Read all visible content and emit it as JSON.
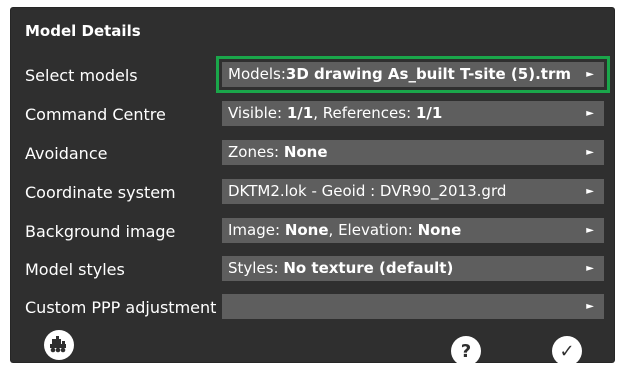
{
  "title": "Model Details",
  "rows": [
    {
      "label": "Select models",
      "prefix": "Models:",
      "value1": "3D drawing As_built T-site (5).trm",
      "mid": "",
      "value2": "",
      "plain": ""
    },
    {
      "label": "Command Centre",
      "prefix": "Visible: ",
      "value1": "1/1",
      "mid": ", References: ",
      "value2": "1/1",
      "plain": ""
    },
    {
      "label": "Avoidance",
      "prefix": "Zones: ",
      "value1": "None",
      "mid": "",
      "value2": "",
      "plain": ""
    },
    {
      "label": "Coordinate system",
      "prefix": "",
      "value1": "",
      "mid": "",
      "value2": "",
      "plain": "DKTM2.lok - Geoid : DVR90_2013.grd"
    },
    {
      "label": "Background image",
      "prefix": "Image: ",
      "value1": "None",
      "mid": ", Elevation: ",
      "value2": "None",
      "plain": ""
    },
    {
      "label": "Model styles",
      "prefix": "Styles: ",
      "value1": "No texture (default)",
      "mid": "",
      "value2": "",
      "plain": ""
    },
    {
      "label": "Custom PPP adjustment",
      "prefix": "",
      "value1": "",
      "mid": "",
      "value2": "",
      "plain": ""
    }
  ],
  "arrow": "►",
  "footer": {
    "machine_icon": "machine-icon",
    "help_glyph": "?",
    "confirm_glyph": "✓"
  },
  "colors": {
    "panel": "#2f2f2f",
    "field": "#5e5e5e",
    "highlight": "#1aa64a"
  }
}
